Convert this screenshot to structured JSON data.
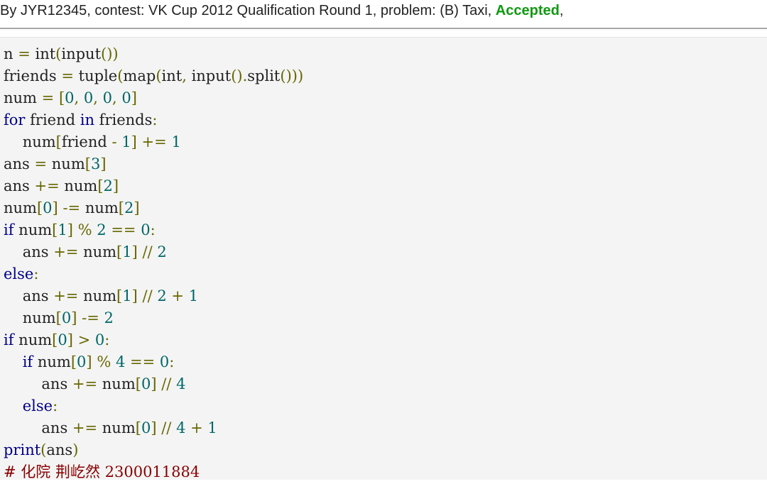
{
  "header": {
    "prefix": "By JYR12345, contest: VK Cup 2012 Qualification Round 1, problem: (B) Taxi, ",
    "verdict": "Accepted",
    "suffix": ","
  },
  "colors": {
    "verdict": "#119911",
    "keyword": "#000088",
    "number": "#006666",
    "punctuation": "#666600",
    "comment": "#880000",
    "code_background": "#f4f4f4"
  },
  "code_lines": [
    [
      [
        "pln",
        "n "
      ],
      [
        "pun",
        "="
      ],
      [
        "pln",
        " int"
      ],
      [
        "pun",
        "("
      ],
      [
        "pln",
        "input"
      ],
      [
        "pun",
        "())"
      ]
    ],
    [
      [
        "pln",
        "friends "
      ],
      [
        "pun",
        "="
      ],
      [
        "pln",
        " tuple"
      ],
      [
        "pun",
        "("
      ],
      [
        "pln",
        "map"
      ],
      [
        "pun",
        "("
      ],
      [
        "pln",
        "int"
      ],
      [
        "pun",
        ","
      ],
      [
        "pln",
        " input"
      ],
      [
        "pun",
        "()."
      ],
      [
        "pln",
        "split"
      ],
      [
        "pun",
        "()))"
      ]
    ],
    [
      [
        "pln",
        "num "
      ],
      [
        "pun",
        "="
      ],
      [
        "pln",
        " "
      ],
      [
        "pun",
        "["
      ],
      [
        "num",
        "0"
      ],
      [
        "pun",
        ","
      ],
      [
        "pln",
        " "
      ],
      [
        "num",
        "0"
      ],
      [
        "pun",
        ","
      ],
      [
        "pln",
        " "
      ],
      [
        "num",
        "0"
      ],
      [
        "pun",
        ","
      ],
      [
        "pln",
        " "
      ],
      [
        "num",
        "0"
      ],
      [
        "pun",
        "]"
      ]
    ],
    [
      [
        "kw",
        "for"
      ],
      [
        "pln",
        " friend "
      ],
      [
        "kw",
        "in"
      ],
      [
        "pln",
        " friends"
      ],
      [
        "pun",
        ":"
      ]
    ],
    [
      [
        "pln",
        "    num"
      ],
      [
        "pun",
        "["
      ],
      [
        "pln",
        "friend "
      ],
      [
        "pun",
        "-"
      ],
      [
        "pln",
        " "
      ],
      [
        "num",
        "1"
      ],
      [
        "pun",
        "]"
      ],
      [
        "pln",
        " "
      ],
      [
        "pun",
        "+="
      ],
      [
        "pln",
        " "
      ],
      [
        "num",
        "1"
      ]
    ],
    [
      [
        "pln",
        "ans "
      ],
      [
        "pun",
        "="
      ],
      [
        "pln",
        " num"
      ],
      [
        "pun",
        "["
      ],
      [
        "num",
        "3"
      ],
      [
        "pun",
        "]"
      ]
    ],
    [
      [
        "pln",
        "ans "
      ],
      [
        "pun",
        "+="
      ],
      [
        "pln",
        " num"
      ],
      [
        "pun",
        "["
      ],
      [
        "num",
        "2"
      ],
      [
        "pun",
        "]"
      ]
    ],
    [
      [
        "pln",
        "num"
      ],
      [
        "pun",
        "["
      ],
      [
        "num",
        "0"
      ],
      [
        "pun",
        "]"
      ],
      [
        "pln",
        " "
      ],
      [
        "pun",
        "-="
      ],
      [
        "pln",
        " num"
      ],
      [
        "pun",
        "["
      ],
      [
        "num",
        "2"
      ],
      [
        "pun",
        "]"
      ]
    ],
    [
      [
        "kw",
        "if"
      ],
      [
        "pln",
        " num"
      ],
      [
        "pun",
        "["
      ],
      [
        "num",
        "1"
      ],
      [
        "pun",
        "]"
      ],
      [
        "pln",
        " "
      ],
      [
        "pun",
        "%"
      ],
      [
        "pln",
        " "
      ],
      [
        "num",
        "2"
      ],
      [
        "pln",
        " "
      ],
      [
        "pun",
        "=="
      ],
      [
        "pln",
        " "
      ],
      [
        "num",
        "0"
      ],
      [
        "pun",
        ":"
      ]
    ],
    [
      [
        "pln",
        "    ans "
      ],
      [
        "pun",
        "+="
      ],
      [
        "pln",
        " num"
      ],
      [
        "pun",
        "["
      ],
      [
        "num",
        "1"
      ],
      [
        "pun",
        "]"
      ],
      [
        "pln",
        " "
      ],
      [
        "pun",
        "//"
      ],
      [
        "pln",
        " "
      ],
      [
        "num",
        "2"
      ]
    ],
    [
      [
        "kw",
        "else"
      ],
      [
        "pun",
        ":"
      ]
    ],
    [
      [
        "pln",
        "    ans "
      ],
      [
        "pun",
        "+="
      ],
      [
        "pln",
        " num"
      ],
      [
        "pun",
        "["
      ],
      [
        "num",
        "1"
      ],
      [
        "pun",
        "]"
      ],
      [
        "pln",
        " "
      ],
      [
        "pun",
        "//"
      ],
      [
        "pln",
        " "
      ],
      [
        "num",
        "2"
      ],
      [
        "pln",
        " "
      ],
      [
        "pun",
        "+"
      ],
      [
        "pln",
        " "
      ],
      [
        "num",
        "1"
      ]
    ],
    [
      [
        "pln",
        "    num"
      ],
      [
        "pun",
        "["
      ],
      [
        "num",
        "0"
      ],
      [
        "pun",
        "]"
      ],
      [
        "pln",
        " "
      ],
      [
        "pun",
        "-="
      ],
      [
        "pln",
        " "
      ],
      [
        "num",
        "2"
      ]
    ],
    [
      [
        "kw",
        "if"
      ],
      [
        "pln",
        " num"
      ],
      [
        "pun",
        "["
      ],
      [
        "num",
        "0"
      ],
      [
        "pun",
        "]"
      ],
      [
        "pln",
        " "
      ],
      [
        "pun",
        ">"
      ],
      [
        "pln",
        " "
      ],
      [
        "num",
        "0"
      ],
      [
        "pun",
        ":"
      ]
    ],
    [
      [
        "pln",
        "    "
      ],
      [
        "kw",
        "if"
      ],
      [
        "pln",
        " num"
      ],
      [
        "pun",
        "["
      ],
      [
        "num",
        "0"
      ],
      [
        "pun",
        "]"
      ],
      [
        "pln",
        " "
      ],
      [
        "pun",
        "%"
      ],
      [
        "pln",
        " "
      ],
      [
        "num",
        "4"
      ],
      [
        "pln",
        " "
      ],
      [
        "pun",
        "=="
      ],
      [
        "pln",
        " "
      ],
      [
        "num",
        "0"
      ],
      [
        "pun",
        ":"
      ]
    ],
    [
      [
        "pln",
        "        ans "
      ],
      [
        "pun",
        "+="
      ],
      [
        "pln",
        " num"
      ],
      [
        "pun",
        "["
      ],
      [
        "num",
        "0"
      ],
      [
        "pun",
        "]"
      ],
      [
        "pln",
        " "
      ],
      [
        "pun",
        "//"
      ],
      [
        "pln",
        " "
      ],
      [
        "num",
        "4"
      ]
    ],
    [
      [
        "pln",
        "    "
      ],
      [
        "kw",
        "else"
      ],
      [
        "pun",
        ":"
      ]
    ],
    [
      [
        "pln",
        "        ans "
      ],
      [
        "pun",
        "+="
      ],
      [
        "pln",
        " num"
      ],
      [
        "pun",
        "["
      ],
      [
        "num",
        "0"
      ],
      [
        "pun",
        "]"
      ],
      [
        "pln",
        " "
      ],
      [
        "pun",
        "//"
      ],
      [
        "pln",
        " "
      ],
      [
        "num",
        "4"
      ],
      [
        "pln",
        " "
      ],
      [
        "pun",
        "+"
      ],
      [
        "pln",
        " "
      ],
      [
        "num",
        "1"
      ]
    ],
    [
      [
        "kw",
        "print"
      ],
      [
        "pun",
        "("
      ],
      [
        "pln",
        "ans"
      ],
      [
        "pun",
        ")"
      ]
    ],
    [
      [
        "com",
        "# 化院 荆屹然 2300011884"
      ]
    ]
  ]
}
